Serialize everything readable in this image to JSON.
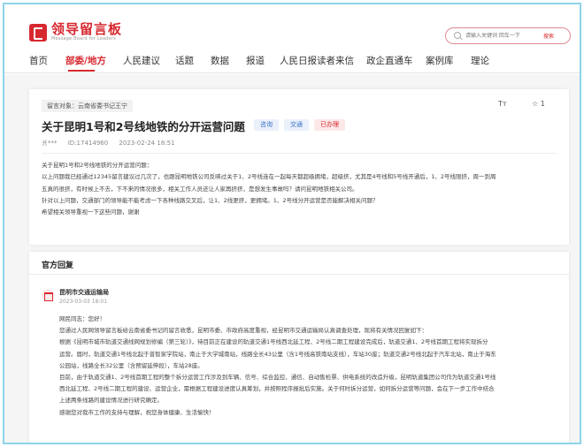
{
  "brand": {
    "title": "领导留言板",
    "subtitle": "Message Board for Leaders"
  },
  "search": {
    "placeholder": "请输入关键词 回车一下",
    "button": "搜索"
  },
  "nav": [
    "首页",
    "部委/地方",
    "人民建议",
    "话题",
    "数据",
    "报道",
    "人民日报读者来信",
    "政企直通车",
    "案例库",
    "理论"
  ],
  "nav_active": "部委/地方",
  "message": {
    "target": "留言对象：云南省委书记王宁",
    "font_size_icon": "Tт",
    "star_count": "1",
    "title": "关于昆明1号和2号线地铁的分开运营问题",
    "badges": [
      "咨询",
      "交通",
      "已办理"
    ],
    "author": "爿***",
    "id": "ID:17414960",
    "time": "2023-02-24 18:51",
    "body": [
      "关于昆明1号和2号线地铁的分开运营问题：",
      "以上问题我已经通过12345留言建议过几次了，也跟昆明地铁公司反映过关于1、2号线连在一起每天都超级拥堵，超级挤，尤其是4号线和5号线开通后，1、2号线限挤，周一到周",
      "五真的很挤，有时候上不去，下不来的情况很多，相关工作人员还让人家再挤挤，是想发生事故吗？请问昆明地铁相关公司。",
      "针对以上问题，交通部门的领导能不能考虑一下各种线路交叉后，让1、2线更挤，更拥堵。1、2号线分开运营是否能解决相关问题？",
      "希望相关领导重视一下这些问题，谢谢"
    ]
  },
  "reply": {
    "heading": "官方回复",
    "org": "昆明市交通运输局",
    "date": "2023-03-03 18:01",
    "body": [
      "网民同志：您好！",
      "您通过人民网领导留言板给云南省委书记的留言收悉，昆明市委、市政府高度重视，经昆明市交通运输局认真调查处理，现将有关情况回复如下：",
      "根据《昆明市城市轨道交通线网规划修编（第三轮）》，待目前正在建设的轨道交通1号线西北延工程、2号线二期工程建设完成后，轨道交通1、2号线首期工程将实现拆分",
      "运营。届时，轨道交通1号线北起于普智家学院站，南止于大学城南站，线路全长43公里（含1号线高铁南站支线），车站30座；轨道交通2号线北起于汽车北站，南止于海东",
      "公园站，线路全长32公里（含预留延伸段），车站28座。",
      "目前，由于轨道交通1、2号线首期工程的整个拆分运营工作涉及到车辆、信号、综合监控、通信、自动售检票、供电系统的改造升级，昆明轨道集团公司作为轨道交通1号线",
      "西北延工程、2号线二期工程的建设、运营企业，需根据工程建设进度认真筹划，并按照程序报批后实施。关于何时拆分运营，如何拆分运营等问题，会在下一步工作中结合",
      "上述两条线路的建设情况进行研究确定。",
      "感谢您对我市工作的支持与理解，祝您身体健康、生活愉快！"
    ]
  },
  "colors": {
    "accent": "#d7282f",
    "frame": "#8fd3ea"
  }
}
